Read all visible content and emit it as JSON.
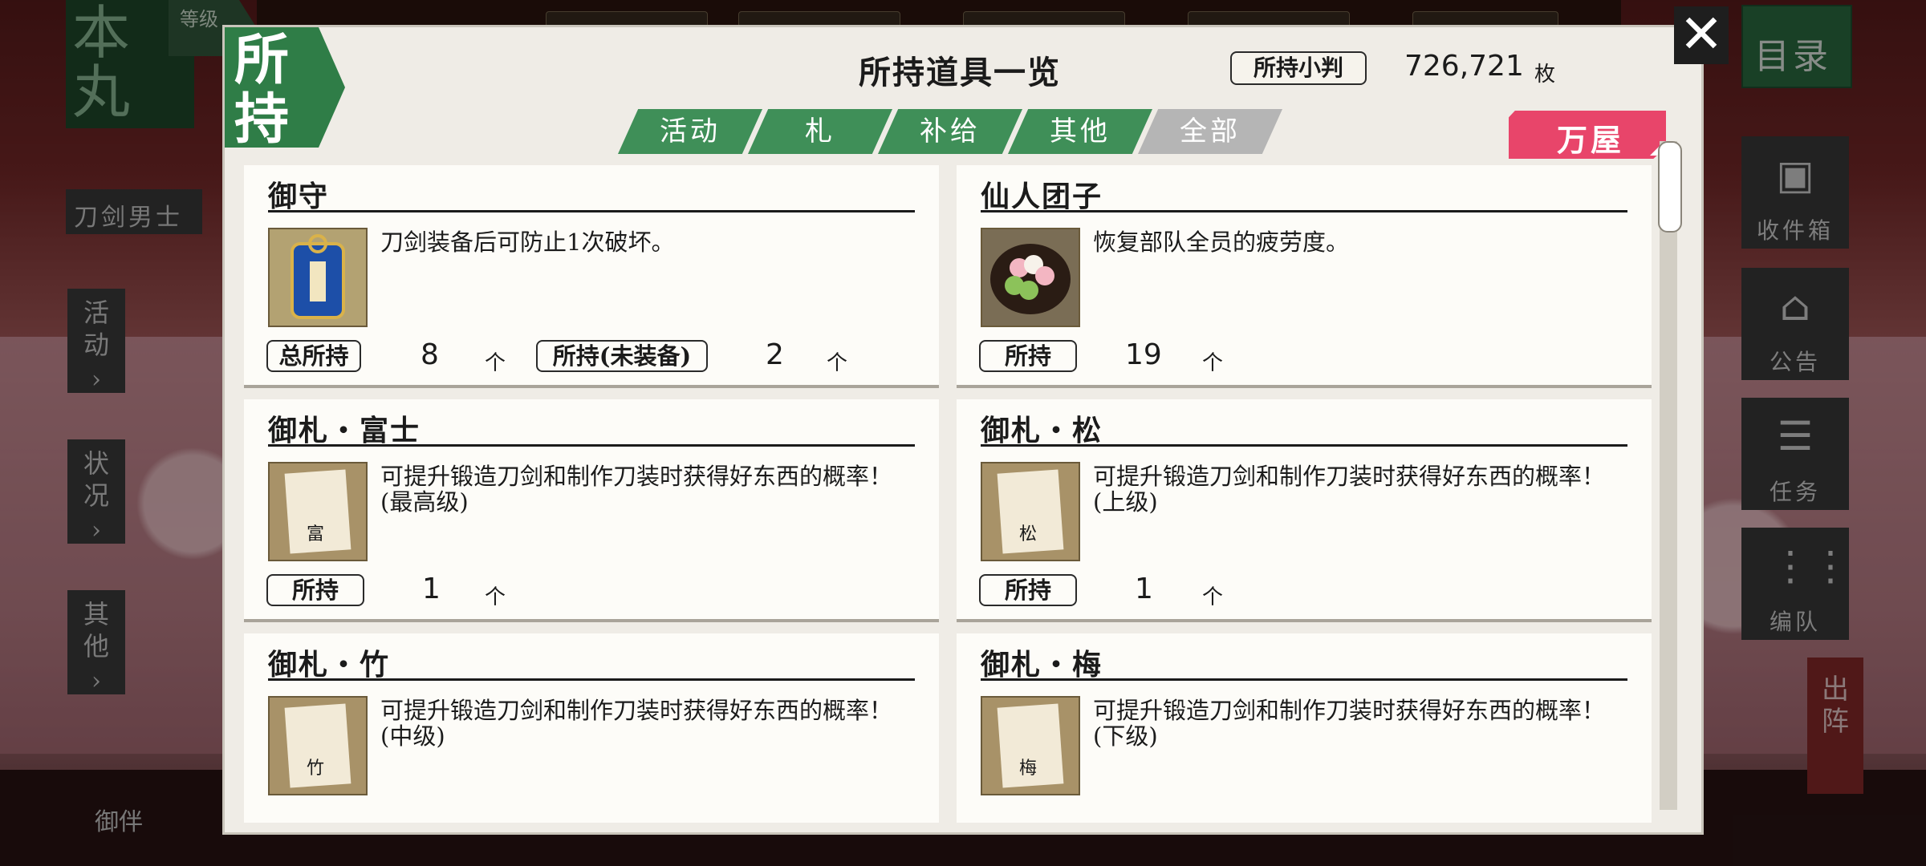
{
  "background": {
    "honmaru_label": "本丸",
    "level_label": "等级",
    "touken_label": "刀剑男士",
    "side_buttons": [
      "活动",
      "状况",
      "其他"
    ],
    "camera_label": "御伴",
    "mokuroku": "目录",
    "right_buttons": [
      {
        "icon": "gift-icon",
        "label": "收件箱"
      },
      {
        "icon": "house-icon",
        "label": "公告"
      },
      {
        "icon": "checklist-icon",
        "label": "任务"
      },
      {
        "icon": "team-icon",
        "label": "编队"
      }
    ],
    "shutsujin": "出阵"
  },
  "modal": {
    "badge": "所持",
    "title": "所持道具一览",
    "koban_label": "所持小判",
    "koban_value": "726,721",
    "koban_unit": "枚",
    "tabs": [
      "活动",
      "札",
      "补给",
      "其他",
      "全部"
    ],
    "active_tab": "全部",
    "shop_button": "万屋",
    "close_symbol": "✕",
    "items": [
      {
        "name": "御守",
        "icon": "omamori-icon",
        "desc": "刀剑装备后可防止1次破坏。",
        "counts": [
          {
            "label": "总所持",
            "value": "8",
            "unit": "个"
          },
          {
            "label": "所持(未装备)",
            "value": "2",
            "unit": "个"
          }
        ]
      },
      {
        "name": "仙人团子",
        "icon": "dango-icon",
        "desc": "恢复部队全员的疲劳度。",
        "counts": [
          {
            "label": "所持",
            "value": "19",
            "unit": "个"
          }
        ]
      },
      {
        "name": "御札・富士",
        "icon": "fuda-fuji-icon",
        "char": "富",
        "desc": "可提升锻造刀剑和制作刀装时获得好东西的概率！(最高级)",
        "counts": [
          {
            "label": "所持",
            "value": "1",
            "unit": "个"
          }
        ]
      },
      {
        "name": "御札・松",
        "icon": "fuda-matsu-icon",
        "char": "松",
        "desc": "可提升锻造刀剑和制作刀装时获得好东西的概率！(上级)",
        "counts": [
          {
            "label": "所持",
            "value": "1",
            "unit": "个"
          }
        ]
      },
      {
        "name": "御札・竹",
        "icon": "fuda-take-icon",
        "char": "竹",
        "desc": "可提升锻造刀剑和制作刀装时获得好东西的概率！(中级)",
        "counts": []
      },
      {
        "name": "御札・梅",
        "icon": "fuda-ume-icon",
        "char": "梅",
        "desc": "可提升锻造刀剑和制作刀装时获得好东西的概率！(下级)",
        "counts": []
      }
    ]
  }
}
